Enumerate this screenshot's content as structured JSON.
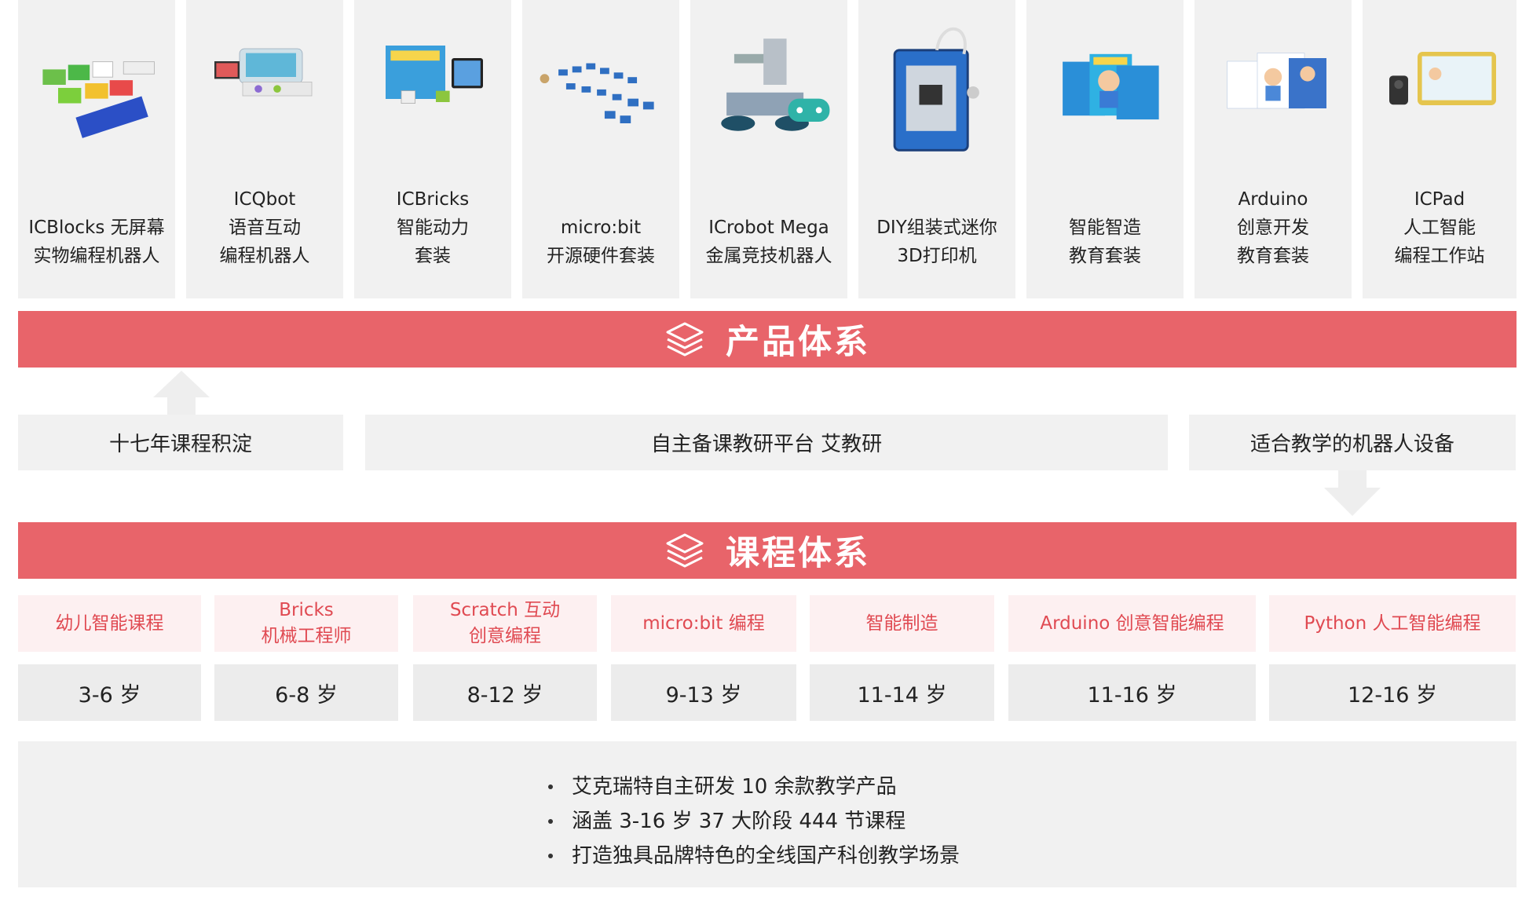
{
  "products": [
    {
      "line1": "ICBlocks 无屏幕",
      "line2": "实物编程机器人",
      "line3": ""
    },
    {
      "line1": "ICQbot",
      "line2": "语音互动",
      "line3": "编程机器人"
    },
    {
      "line1": "ICBricks",
      "line2": "智能动力",
      "line3": "套装"
    },
    {
      "line1": "micro:bit",
      "line2": "开源硬件套装",
      "line3": ""
    },
    {
      "line1": "ICrobot Mega",
      "line2": "金属竞技机器人",
      "line3": ""
    },
    {
      "line1": "DIY组装式迷你",
      "line2": "3D打印机",
      "line3": ""
    },
    {
      "line1": "智能智造",
      "line2": "教育套装",
      "line3": ""
    },
    {
      "line1": "Arduino",
      "line2": "创意开发",
      "line3": "教育套装"
    },
    {
      "line1": "ICPad",
      "line2": "人工智能",
      "line3": "编程工作站"
    }
  ],
  "product_banner": {
    "title": "产品体系",
    "icon": "layers-icon"
  },
  "foundations": {
    "left": "十七年课程积淀",
    "center": "自主备课教研平台  艾教研",
    "right": "适合教学的机器人设备"
  },
  "course_banner": {
    "title": "课程体系",
    "icon": "layers-icon"
  },
  "courses": [
    {
      "name": "幼儿智能课程",
      "age": "3-6 岁"
    },
    {
      "name": "Bricks\n机械工程师",
      "age": "6-8 岁"
    },
    {
      "name": "Scratch 互动\n创意编程",
      "age": "8-12 岁"
    },
    {
      "name": "micro:bit 编程",
      "age": "9-13 岁"
    },
    {
      "name": "智能制造",
      "age": "11-14 岁"
    },
    {
      "name": "Arduino 创意智能编程",
      "age": "11-16 岁"
    },
    {
      "name": "Python 人工智能编程",
      "age": "12-16 岁"
    }
  ],
  "summary": [
    "艾克瑞特自主研发 10 余款教学产品",
    "涵盖 3-16 岁 37 大阶段 444 节课程",
    "打造独具品牌特色的全线国产科创教学场景"
  ],
  "colors": {
    "accent": "#e8646a",
    "course_text": "#e04a52",
    "card_bg": "#f1f1f1"
  }
}
